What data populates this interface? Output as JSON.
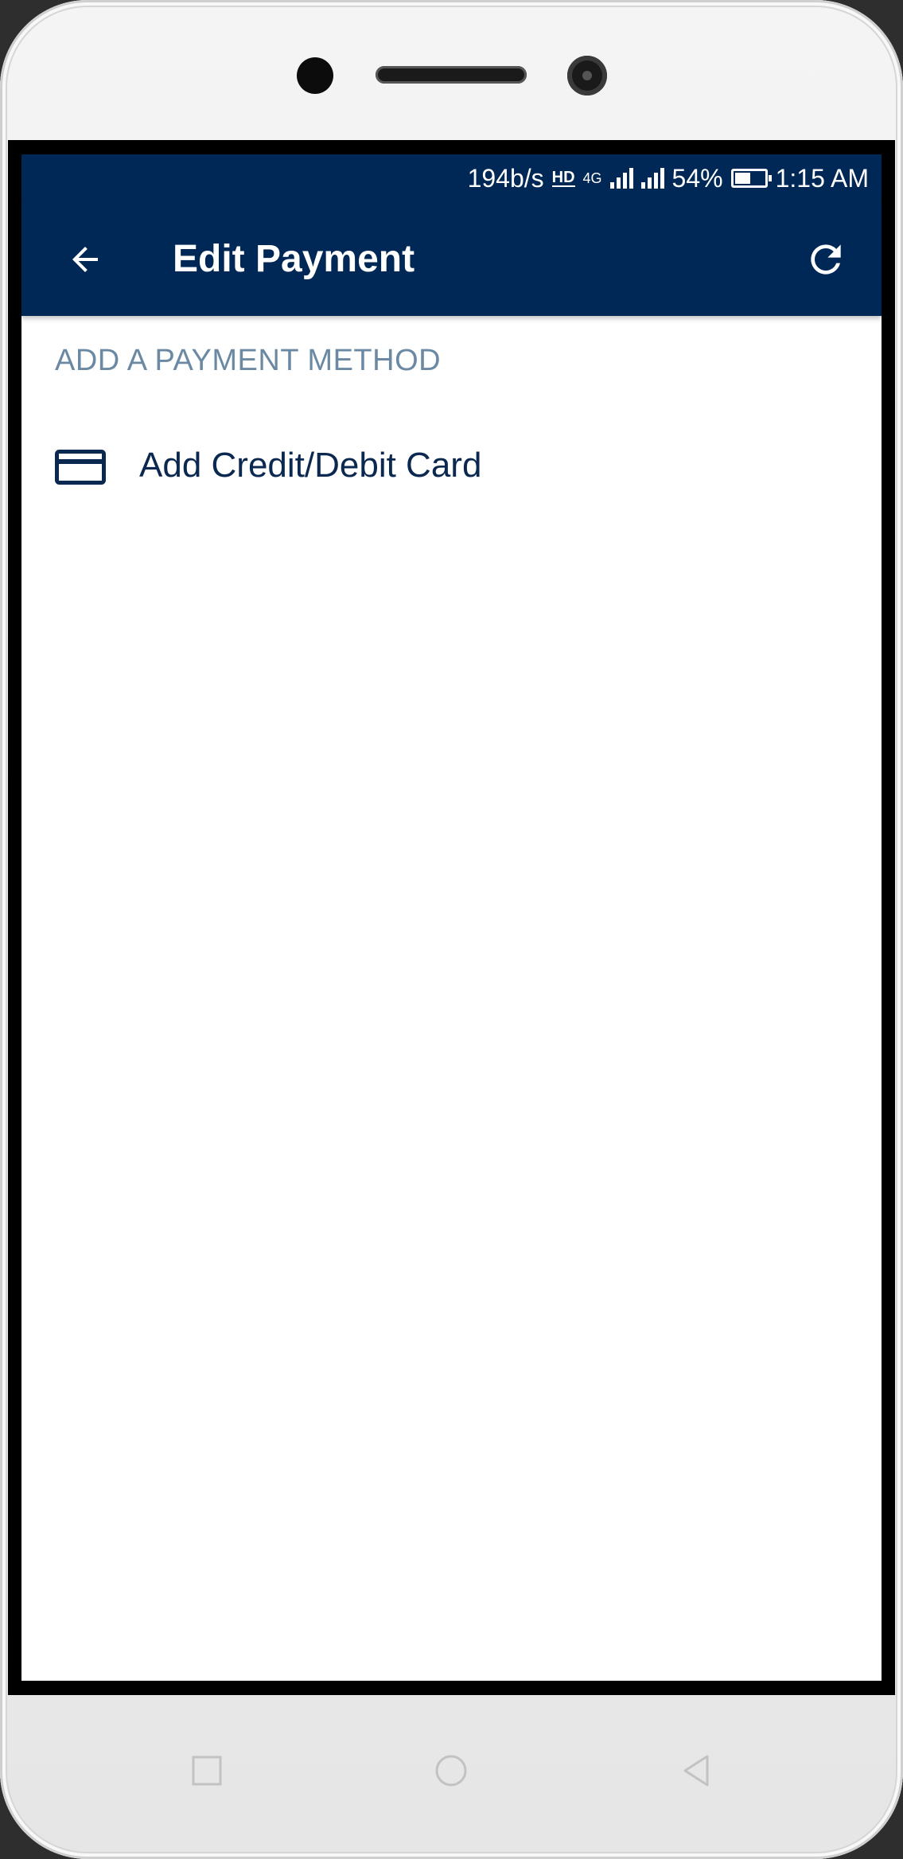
{
  "status_bar": {
    "net_speed": "194b/s",
    "hd": "HD",
    "network": "4G",
    "battery_percent": "54%",
    "time": "1:15 AM"
  },
  "toolbar": {
    "title": "Edit Payment",
    "back_icon": "arrow-left-icon",
    "refresh_icon": "refresh-icon"
  },
  "section": {
    "header": "ADD A PAYMENT METHOD"
  },
  "payment_options": [
    {
      "label": "Add Credit/Debit Card",
      "icon": "credit-card-icon"
    }
  ],
  "nav_bar": {
    "buttons": [
      "recent-apps-icon",
      "home-icon",
      "back-icon"
    ]
  },
  "colors": {
    "primary": "#002856",
    "section_header": "#6b89a3",
    "item_text": "#0b2850"
  }
}
